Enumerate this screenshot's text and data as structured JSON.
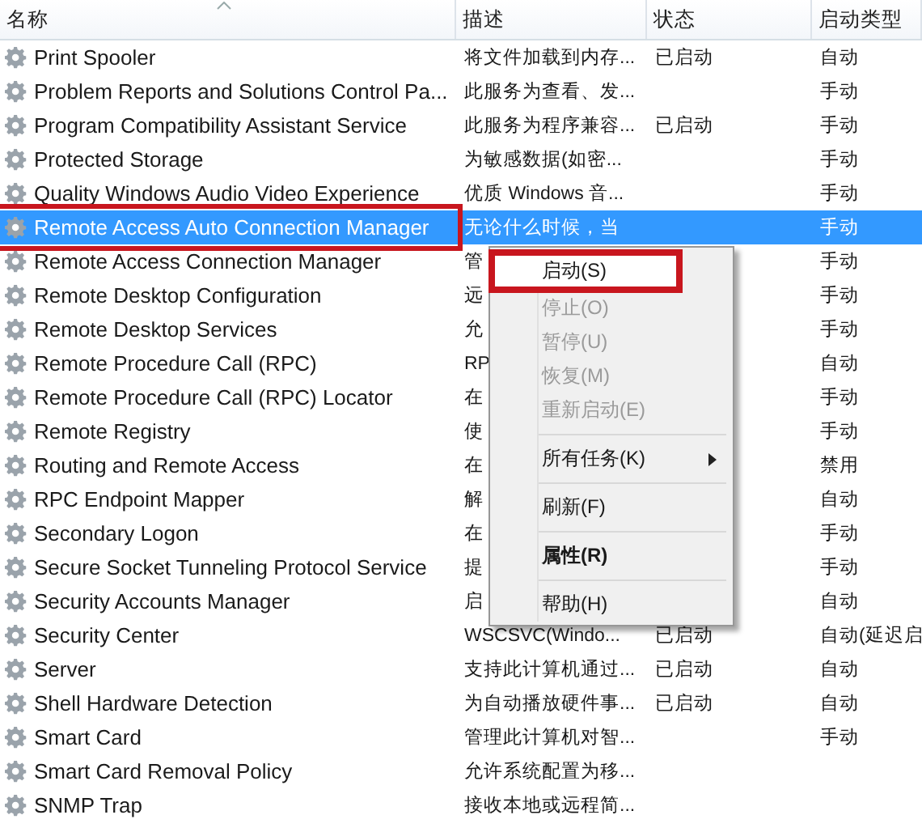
{
  "columns": [
    {
      "label": "名称",
      "sorted": true
    },
    {
      "label": "描述",
      "sorted": false
    },
    {
      "label": "状态",
      "sorted": false
    },
    {
      "label": "启动类型",
      "sorted": false
    }
  ],
  "rows": [
    {
      "name": "Print Spooler",
      "description": "将文件加载到内存...",
      "status": "已启动",
      "startup": "自动",
      "selected": false,
      "annotated": false
    },
    {
      "name": "Problem Reports and Solutions Control Pa...",
      "description": "此服务为查看、发...",
      "startup": "手动",
      "selected": false,
      "annotated": false
    },
    {
      "name": "Program Compatibility Assistant Service",
      "description": "此服务为程序兼容...",
      "status": "已启动",
      "startup": "手动",
      "selected": false,
      "annotated": false
    },
    {
      "name": "Protected Storage",
      "description": "为敏感数据(如密...",
      "startup": "手动",
      "selected": false,
      "annotated": false
    },
    {
      "name": "Quality Windows Audio Video Experience",
      "description": "优质 Windows 音...",
      "startup": "手动",
      "selected": false,
      "annotated": false
    },
    {
      "name": "Remote Access Auto Connection Manager",
      "description": "无论什么时候，当",
      "startup": "手动",
      "selected": true,
      "annotated": true
    },
    {
      "name": "Remote Access Connection Manager",
      "description": "管",
      "startup": "手动",
      "selected": false,
      "annotated": false
    },
    {
      "name": "Remote Desktop Configuration",
      "description": "远",
      "startup": "手动",
      "selected": false,
      "annotated": false
    },
    {
      "name": "Remote Desktop Services",
      "description": "允",
      "startup": "手动",
      "selected": false,
      "annotated": false
    },
    {
      "name": "Remote Procedure Call (RPC)",
      "description": "RP",
      "startup": "自动",
      "selected": false,
      "annotated": false
    },
    {
      "name": "Remote Procedure Call (RPC) Locator",
      "description": "在",
      "startup": "手动",
      "selected": false,
      "annotated": false
    },
    {
      "name": "Remote Registry",
      "description": "使",
      "startup": "手动",
      "selected": false,
      "annotated": false
    },
    {
      "name": "Routing and Remote Access",
      "description": "在",
      "startup": "禁用",
      "selected": false,
      "annotated": false
    },
    {
      "name": "RPC Endpoint Mapper",
      "description": "解",
      "startup": "自动",
      "selected": false,
      "annotated": false
    },
    {
      "name": "Secondary Logon",
      "description": "在",
      "startup": "手动",
      "selected": false,
      "annotated": false
    },
    {
      "name": "Secure Socket Tunneling Protocol Service",
      "description": "提",
      "startup": "手动",
      "selected": false,
      "annotated": false
    },
    {
      "name": "Security Accounts Manager",
      "description": "启",
      "startup": "自动",
      "selected": false,
      "annotated": false
    },
    {
      "name": "Security Center",
      "description": "WSCSVC(Windo...",
      "status": "已启动",
      "startup": "自动(延迟启",
      "selected": false,
      "annotated": false
    },
    {
      "name": "Server",
      "description": "支持此计算机通过...",
      "status": "已启动",
      "startup": "自动",
      "selected": false,
      "annotated": false
    },
    {
      "name": "Shell Hardware Detection",
      "description": "为自动播放硬件事...",
      "status": "已启动",
      "startup": "自动",
      "selected": false,
      "annotated": false
    },
    {
      "name": "Smart Card",
      "description": "管理此计算机对智...",
      "startup": "手动",
      "selected": false,
      "annotated": false
    },
    {
      "name": "Smart Card Removal Policy",
      "description": "允许系统配置为移...",
      "selected": false,
      "annotated": false
    },
    {
      "name": "SNMP Trap",
      "description": "接收本地或远程简...",
      "selected": false,
      "annotated": false
    }
  ],
  "context_menu": [
    {
      "kind": "item",
      "label": "启动(S)",
      "disabled": false,
      "bold": false,
      "submenu": false,
      "annotated": true
    },
    {
      "kind": "item",
      "label": "停止(O)",
      "disabled": true,
      "bold": false,
      "submenu": false,
      "annotated": false
    },
    {
      "kind": "item",
      "label": "暂停(U)",
      "disabled": true,
      "bold": false,
      "submenu": false,
      "annotated": false
    },
    {
      "kind": "item",
      "label": "恢复(M)",
      "disabled": true,
      "bold": false,
      "submenu": false,
      "annotated": false
    },
    {
      "kind": "item",
      "label": "重新启动(E)",
      "disabled": true,
      "bold": false,
      "submenu": false,
      "annotated": false
    },
    {
      "kind": "separator"
    },
    {
      "kind": "item",
      "label": "所有任务(K)",
      "disabled": false,
      "bold": false,
      "submenu": true,
      "annotated": false
    },
    {
      "kind": "separator"
    },
    {
      "kind": "item",
      "label": "刷新(F)",
      "disabled": false,
      "bold": false,
      "submenu": false,
      "annotated": false
    },
    {
      "kind": "separator"
    },
    {
      "kind": "item",
      "label": "属性(R)",
      "disabled": false,
      "bold": true,
      "submenu": false,
      "annotated": false
    },
    {
      "kind": "separator"
    },
    {
      "kind": "item",
      "label": "帮助(H)",
      "disabled": false,
      "bold": false,
      "submenu": false,
      "annotated": false
    }
  ]
}
